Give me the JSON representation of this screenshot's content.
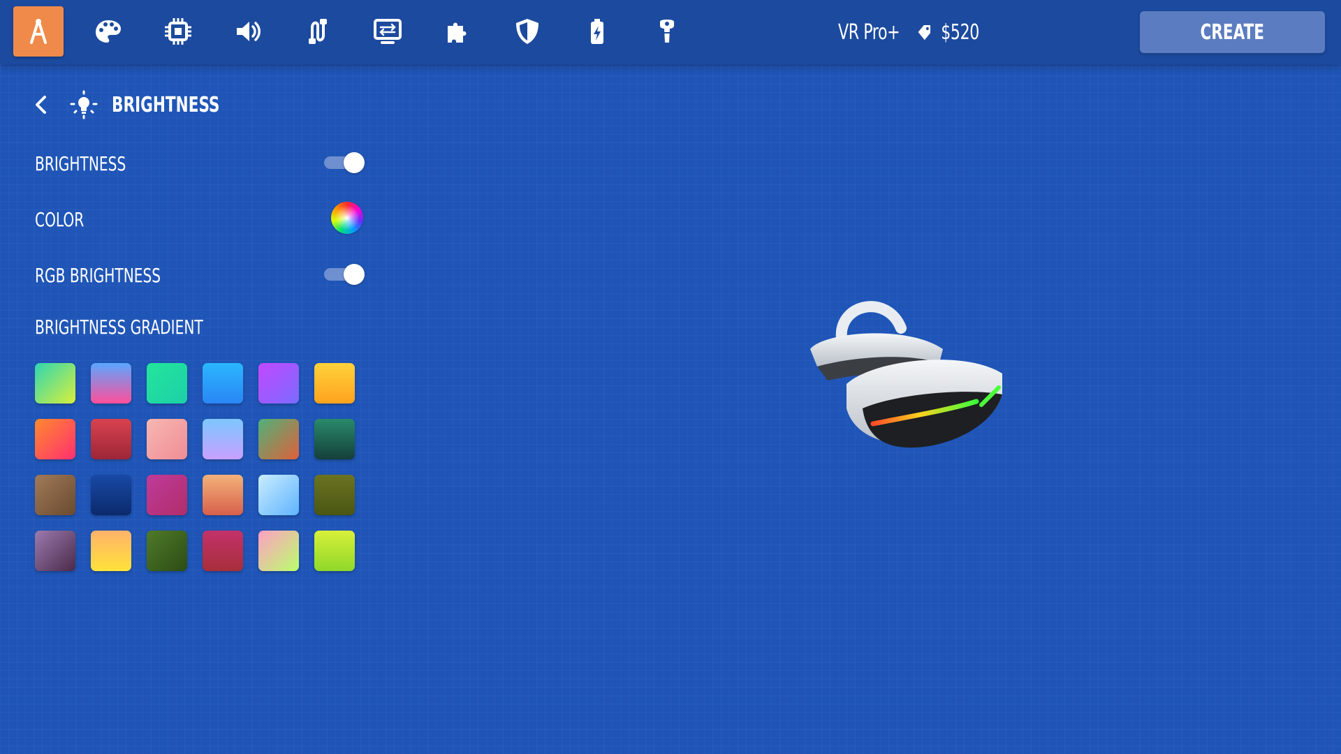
{
  "nav": {
    "icons": [
      {
        "name": "design-tool-icon",
        "active": true
      },
      {
        "name": "palette-icon",
        "active": false
      },
      {
        "name": "processor-icon",
        "active": false
      },
      {
        "name": "speaker-icon",
        "active": false
      },
      {
        "name": "connector-icon",
        "active": false
      },
      {
        "name": "display-icon",
        "active": false
      },
      {
        "name": "puzzle-icon",
        "active": false
      },
      {
        "name": "shield-icon",
        "active": false
      },
      {
        "name": "battery-icon",
        "active": false
      },
      {
        "name": "controller-icon",
        "active": false
      }
    ],
    "active_color": "#f08a4b"
  },
  "product": {
    "name": "VR Pro+",
    "price": "$520"
  },
  "create_button": {
    "label": "CREATE"
  },
  "panel": {
    "title": "BRIGHTNESS",
    "settings": [
      {
        "label": "BRIGHTNESS",
        "control": "toggle",
        "on": true
      },
      {
        "label": "COLOR",
        "control": "color-wheel"
      },
      {
        "label": "RGB BRIGHTNESS",
        "control": "toggle",
        "on": true
      }
    ],
    "gradient_title": "BRIGHTNESS GRADIENT",
    "gradients": [
      [
        "#2fd6b3",
        "#d9f03a"
      ],
      [
        "#5aa7ff",
        "#ff4f9a"
      ],
      [
        "#23e59b",
        "#1dd0a8"
      ],
      [
        "#2bb6ff",
        "#2a86f5"
      ],
      [
        "#c248ff",
        "#7a6bff"
      ],
      [
        "#ffd23a",
        "#ffa21e"
      ],
      [
        "#ff8a2e",
        "#ff2e70"
      ],
      [
        "#d9424f",
        "#9c2638"
      ],
      [
        "#f7b7b2",
        "#f08d95"
      ],
      [
        "#7cc7ff",
        "#c8a0ff"
      ],
      [
        "#4fb27a",
        "#e0603a"
      ],
      [
        "#2a8a6a",
        "#143f3a"
      ],
      [
        "#a07a5a",
        "#6a4a2e"
      ],
      [
        "#1849a6",
        "#0b2a6c"
      ],
      [
        "#c03a9a",
        "#b02e6a"
      ],
      [
        "#f3b27a",
        "#d7604a"
      ],
      [
        "#c9ecff",
        "#5fb4ff"
      ],
      [
        "#6b7322",
        "#4a5612"
      ],
      [
        "#9c7ab0",
        "#4a2a48"
      ],
      [
        "#ffb36b",
        "#ffe23a"
      ],
      [
        "#4f7a2a",
        "#2c4c14"
      ],
      [
        "#c2326b",
        "#a82e3a"
      ],
      [
        "#ff9fc4",
        "#b9ff6b"
      ],
      [
        "#d8f03a",
        "#8fd82a"
      ]
    ]
  }
}
